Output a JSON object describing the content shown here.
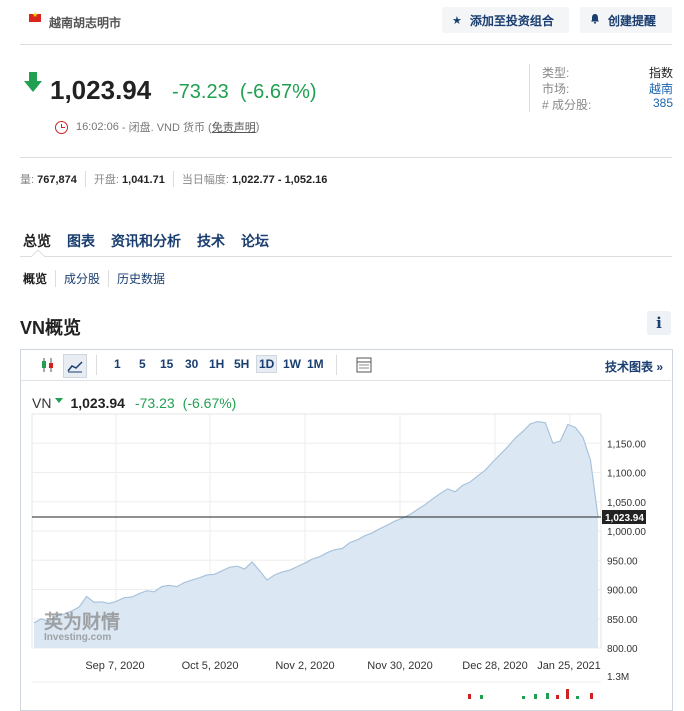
{
  "header": {
    "region": "越南胡志明市",
    "add_portfolio": "添加至投资组合",
    "create_alert": "创建提醒"
  },
  "quote": {
    "price": "1,023.94",
    "change": "-73.23",
    "change_pct": "(-6.67%)",
    "time": "16:02:06",
    "status_text": "- 闭盘. VND 货币 (",
    "disclaimer": "免责声明",
    "close_paren": ")"
  },
  "side_info": {
    "rows": [
      {
        "key": "类型:",
        "value": "指数"
      },
      {
        "key": "市场:",
        "value": "越南"
      },
      {
        "key": "# 成分股:",
        "value": "385"
      }
    ]
  },
  "stats": {
    "volume_label": "量:",
    "volume": "767,874",
    "open_label": "开盘:",
    "open": "1,041.71",
    "range_label": "当日幅度:",
    "range": "1,022.77 - 1,052.16"
  },
  "tabs": [
    "总览",
    "图表",
    "资讯和分析",
    "技术",
    "论坛"
  ],
  "subtabs": [
    "概览",
    "成分股",
    "历史数据"
  ],
  "section_title": "VN概览",
  "info_glyph": "i",
  "chart_toolbar": {
    "timeframes": [
      "1",
      "5",
      "15",
      "30",
      "1H",
      "5H",
      "1D",
      "1W",
      "1M"
    ],
    "selected": "1D",
    "tech_chart_link": "技术图表 »"
  },
  "chart_legend": {
    "symbol": "VN",
    "price": "1,023.94",
    "change": "-73.23",
    "change_pct": "(-6.67%)"
  },
  "watermark": {
    "main": "英为财情",
    "sub": "Investing.com"
  },
  "chart_data": {
    "type": "area",
    "x_ticks": [
      "Sep 7, 2020",
      "Oct 5, 2020",
      "Nov 2, 2020",
      "Nov 30, 2020",
      "Dec 28, 2020",
      "Jan 25, 2021"
    ],
    "y_ticks": [
      "1,150.00",
      "1,100.00",
      "1,050.00",
      "1,000.00",
      "950.00",
      "900.00",
      "850.00",
      "800.00"
    ],
    "ylim": [
      800,
      1200
    ],
    "last_price_label": "1,023.94",
    "volume_axis_label": "1.3M",
    "series": [
      {
        "values": [
          843,
          850,
          845,
          855,
          858,
          863,
          870,
          888,
          878,
          879,
          876,
          880,
          886,
          887,
          893,
          898,
          896,
          905,
          907,
          905,
          912,
          916,
          920,
          925,
          926,
          932,
          938,
          940,
          935,
          947,
          932,
          916,
          925,
          930,
          933,
          939,
          945,
          952,
          956,
          963,
          968,
          970,
          980,
          985,
          992,
          997,
          1004,
          1010,
          1017,
          1022,
          1028,
          1037,
          1045,
          1055,
          1064,
          1072,
          1067,
          1078,
          1084,
          1094,
          1104,
          1118,
          1131,
          1144,
          1159,
          1170,
          1183,
          1187,
          1185,
          1150,
          1154,
          1182,
          1177,
          1160,
          1121,
          1024
        ]
      }
    ]
  },
  "colors": {
    "accent": "#1a3e70",
    "up": "#20a050",
    "down": "#20a050",
    "alert": "#d02020",
    "area_fill": "#dbe8f3",
    "area_line": "#a9c3dc"
  }
}
